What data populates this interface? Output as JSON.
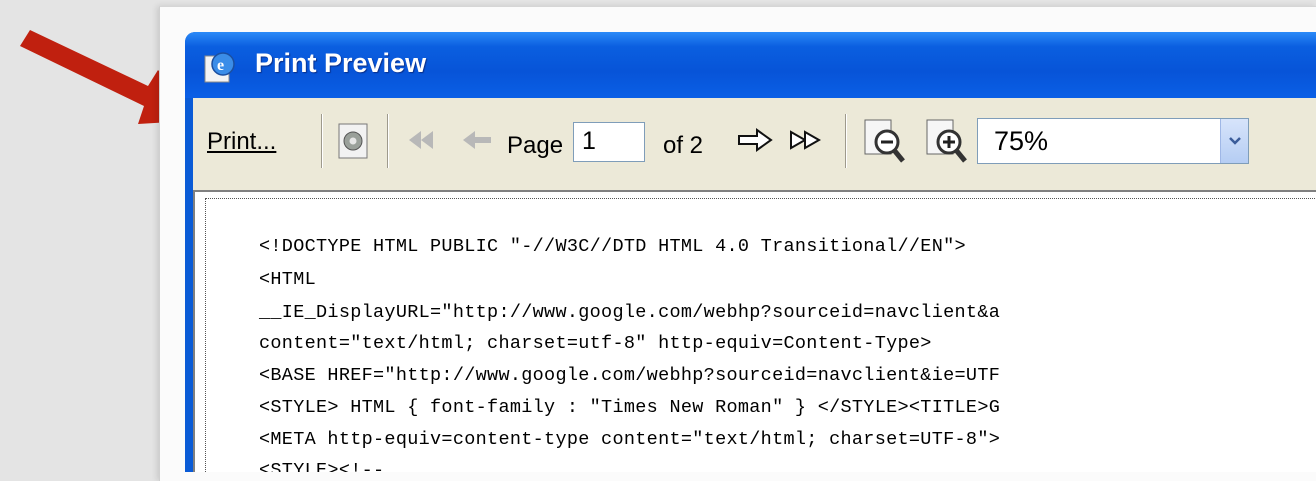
{
  "window": {
    "title": "Print Preview"
  },
  "toolbar": {
    "print_label": "Print...",
    "page_label": "Page",
    "page_value": "1",
    "of_label": "of 2",
    "zoom_value": "75%",
    "icons": [
      "page-setup-icon",
      "first-page-icon",
      "previous-page-icon",
      "next-page-icon",
      "last-page-icon",
      "zoom-out-icon",
      "zoom-in-icon",
      "dropdown-arrow-icon"
    ]
  },
  "preview": {
    "lines": [
      "<!DOCTYPE HTML PUBLIC \"-//W3C//DTD HTML 4.0 Transitional//EN\">",
      "<HTML",
      "__IE_DisplayURL=\"http://www.google.com/webhp?sourceid=navclient&a",
      "content=\"text/html; charset=utf-8\" http-equiv=Content-Type>",
      "<BASE HREF=\"http://www.google.com/webhp?sourceid=navclient&ie=UTF",
      "<STYLE> HTML { font-family : \"Times New Roman\" } </STYLE><TITLE>G",
      "<META http-equiv=content-type content=\"text/html; charset=UTF-8\">",
      "<STYLE><!--"
    ]
  },
  "annotation": {
    "arrow_color": "#c0200f"
  },
  "colors": {
    "titlebar": "#0754d8",
    "toolbar_bg": "#ece9d8"
  }
}
